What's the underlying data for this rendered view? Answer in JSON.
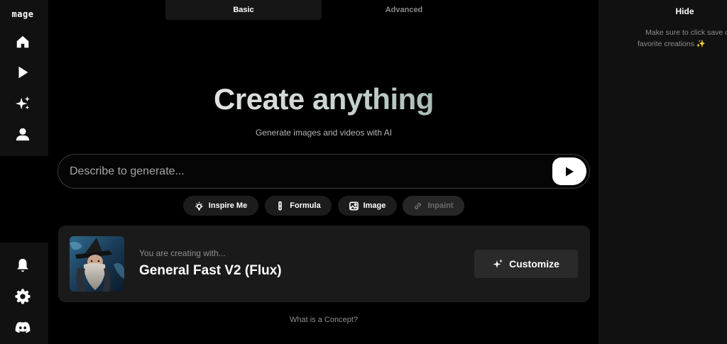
{
  "brand": {
    "logo_text": "mage"
  },
  "sidebar": {
    "top_items": [
      {
        "name": "home",
        "icon": "home-icon"
      },
      {
        "name": "play",
        "icon": "play-icon"
      },
      {
        "name": "create",
        "icon": "sparkles-icon"
      },
      {
        "name": "profile",
        "icon": "user-icon"
      }
    ],
    "bottom_items": [
      {
        "name": "notifications",
        "icon": "bell-icon"
      },
      {
        "name": "settings",
        "icon": "gear-icon"
      },
      {
        "name": "discord",
        "icon": "discord-icon"
      }
    ]
  },
  "tabs": [
    {
      "label": "Basic",
      "active": true
    },
    {
      "label": "Advanced",
      "active": false
    }
  ],
  "hero": {
    "title": "Create anything",
    "subtitle": "Generate images and videos with AI"
  },
  "prompt": {
    "placeholder": "Describe to generate...",
    "value": ""
  },
  "chips": [
    {
      "label": "Inspire Me",
      "icon": "lightbulb-icon",
      "disabled": false
    },
    {
      "label": "Formula",
      "icon": "flask-icon",
      "disabled": false
    },
    {
      "label": "Image",
      "icon": "image-icon",
      "disabled": false
    },
    {
      "label": "Inpaint",
      "icon": "link-icon",
      "disabled": true
    }
  ],
  "model_card": {
    "label": "You are creating with...",
    "model_name": "General Fast V2 (Flux)",
    "customize_label": "Customize"
  },
  "concept_link": "What is a Concept?",
  "right_panel": {
    "hide_label": "Hide",
    "hint_line1": "Make sure to click save on y",
    "hint_line2": "favorite creations ✨"
  },
  "colors": {
    "background": "#000000",
    "sidebar": "#111111",
    "card": "#1a1a1a",
    "chip": "#1c1c1c",
    "accent_title_start": "#e6e6e6",
    "accent_title_end": "#9fb4ac"
  }
}
